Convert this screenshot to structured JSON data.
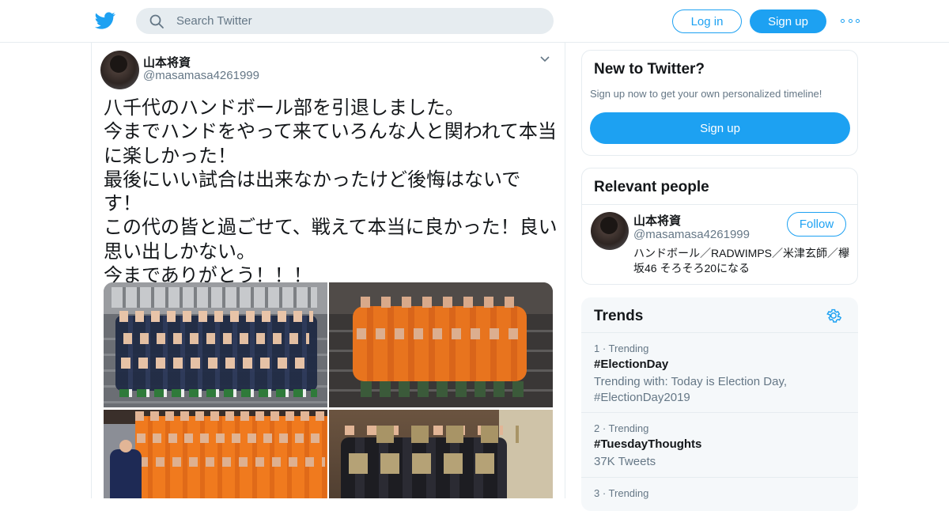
{
  "header": {
    "search_placeholder": "Search Twitter",
    "login_label": "Log in",
    "signup_label": "Sign up",
    "brand_color": "#1da1f2"
  },
  "tweet": {
    "display_name": "山本将資",
    "handle": "@masamasa4261999",
    "text": "八千代のハンドボール部を引退しました。\n今までハンドをやって来ていろんな人と関われて本当に楽しかった！\n最後にいい試合は出来なかったけど後悔はないです！\nこの代の皆と過ごせて、戦えて本当に良かった！良い思い出しかない。\n今までありがとう！！！",
    "photos": [
      "team-photo-1",
      "team-photo-2",
      "team-photo-3",
      "team-photo-4"
    ]
  },
  "sidebar": {
    "new_to_twitter": {
      "title": "New to Twitter?",
      "subtitle": "Sign up now to get your own personalized timeline!",
      "button": "Sign up"
    },
    "relevant_people": {
      "title": "Relevant people",
      "name": "山本将資",
      "handle": "@masamasa4261999",
      "follow_label": "Follow",
      "bio": "ハンドボール／RADWIMPS／米津玄師／欅坂46 そろそろ20になる"
    },
    "trends": {
      "title": "Trends",
      "items": [
        {
          "meta": "1 · Trending",
          "name": "#ElectionDay",
          "desc": "Trending with: Today is Election Day, #ElectionDay2019"
        },
        {
          "meta": "2 · Trending",
          "name": "#TuesdayThoughts",
          "desc": "37K Tweets"
        },
        {
          "meta": "3 · Trending",
          "name": "",
          "desc": ""
        }
      ]
    }
  }
}
